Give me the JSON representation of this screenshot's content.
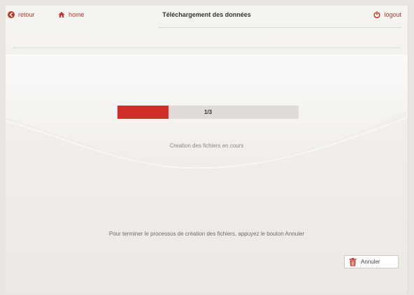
{
  "header": {
    "back_label": "retour",
    "home_label": "home",
    "title": "Téléchargement des données",
    "logout_label": "logout"
  },
  "progress": {
    "label": "1/3",
    "current": 1,
    "total": 3,
    "fraction": 0.28,
    "status": "Creation des fichiers en cours"
  },
  "footer": {
    "instruction": "Pour terminer le processus de création des fichiers, appuyez le bouton Annuler",
    "cancel_label": "Annuler"
  },
  "icons": {
    "back": "back-arrow-circle-icon",
    "home": "home-icon",
    "logout": "power-icon",
    "cancel": "trash-icon"
  },
  "colors": {
    "accent": "#c0392b",
    "progress_fill": "#d12f2b",
    "progress_track": "#dedbd8",
    "background": "#f3f1ed"
  }
}
